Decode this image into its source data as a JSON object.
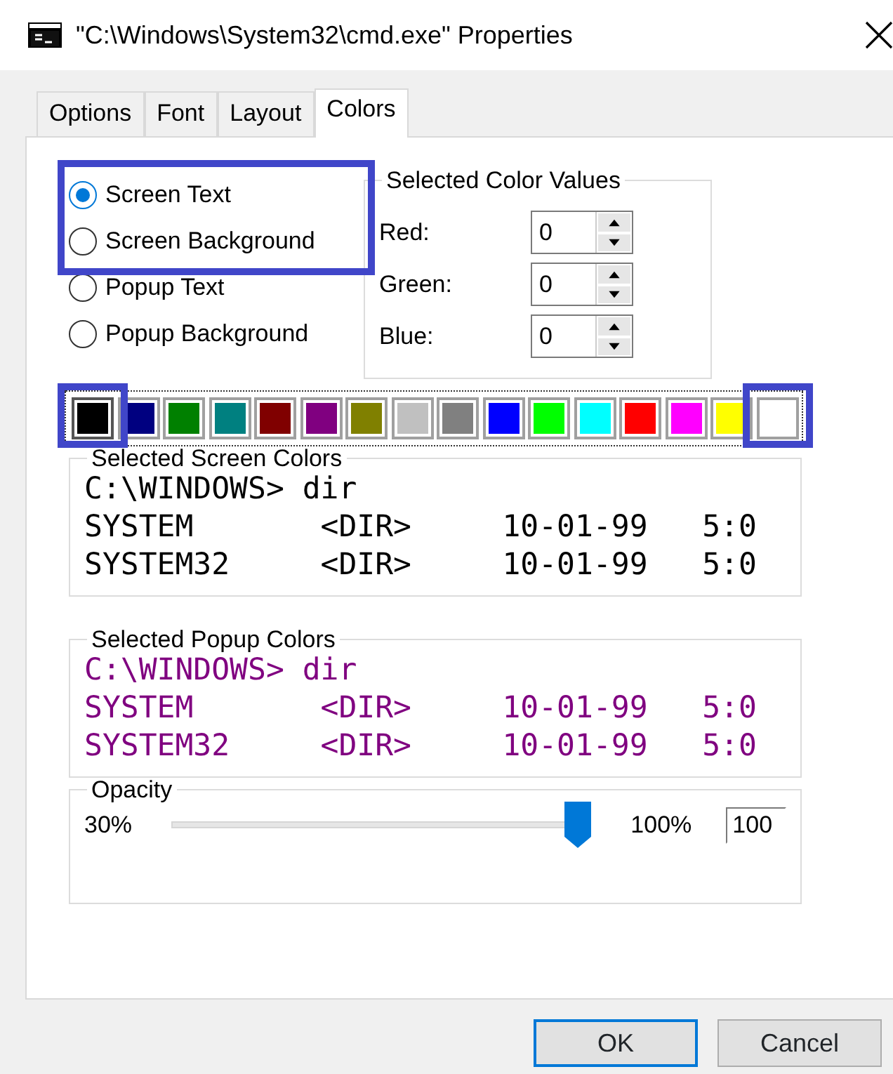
{
  "window": {
    "title": "\"C:\\Windows\\System32\\cmd.exe\" Properties"
  },
  "tabs": [
    {
      "label": "Options",
      "selected": false
    },
    {
      "label": "Font",
      "selected": false
    },
    {
      "label": "Layout",
      "selected": false
    },
    {
      "label": "Colors",
      "selected": true
    }
  ],
  "color_targets": [
    {
      "label": "Screen Text",
      "selected": true,
      "highlighted": true
    },
    {
      "label": "Screen Background",
      "selected": false,
      "highlighted": true
    },
    {
      "label": "Popup Text",
      "selected": false,
      "highlighted": false
    },
    {
      "label": "Popup Background",
      "selected": false,
      "highlighted": false
    }
  ],
  "selected_color_values": {
    "title": "Selected Color Values",
    "fields": [
      {
        "label": "Red:",
        "value": "0"
      },
      {
        "label": "Green:",
        "value": "0"
      },
      {
        "label": "Blue:",
        "value": "0"
      }
    ]
  },
  "palette": [
    {
      "color": "#000000",
      "selected": true,
      "highlighted": true
    },
    {
      "color": "#000080",
      "selected": false,
      "highlighted": false
    },
    {
      "color": "#008000",
      "selected": false,
      "highlighted": false
    },
    {
      "color": "#008080",
      "selected": false,
      "highlighted": false
    },
    {
      "color": "#800000",
      "selected": false,
      "highlighted": false
    },
    {
      "color": "#800080",
      "selected": false,
      "highlighted": false
    },
    {
      "color": "#808000",
      "selected": false,
      "highlighted": false
    },
    {
      "color": "#c0c0c0",
      "selected": false,
      "highlighted": false
    },
    {
      "color": "#808080",
      "selected": false,
      "highlighted": false
    },
    {
      "color": "#0000ff",
      "selected": false,
      "highlighted": false
    },
    {
      "color": "#00ff00",
      "selected": false,
      "highlighted": false
    },
    {
      "color": "#00ffff",
      "selected": false,
      "highlighted": false
    },
    {
      "color": "#ff0000",
      "selected": false,
      "highlighted": false
    },
    {
      "color": "#ff00ff",
      "selected": false,
      "highlighted": false
    },
    {
      "color": "#ffff00",
      "selected": false,
      "highlighted": false
    },
    {
      "color": "#ffffff",
      "selected": false,
      "highlighted": true
    }
  ],
  "previews": [
    {
      "title": "Selected Screen Colors",
      "color": "#000000",
      "lines": [
        "C:\\WINDOWS> dir",
        "SYSTEM       <DIR>     10-01-99   5:0",
        "SYSTEM32     <DIR>     10-01-99   5:0"
      ]
    },
    {
      "title": "Selected Popup Colors",
      "color": "#800080",
      "lines": [
        "C:\\WINDOWS> dir",
        "SYSTEM       <DIR>     10-01-99   5:0",
        "SYSTEM32     <DIR>     10-01-99   5:0"
      ]
    }
  ],
  "opacity": {
    "title": "Opacity",
    "min_label": "30%",
    "max_label": "100%",
    "level": 1,
    "value": "100"
  },
  "buttons": [
    {
      "label": "OK",
      "default": true
    },
    {
      "label": "Cancel",
      "default": false
    }
  ]
}
